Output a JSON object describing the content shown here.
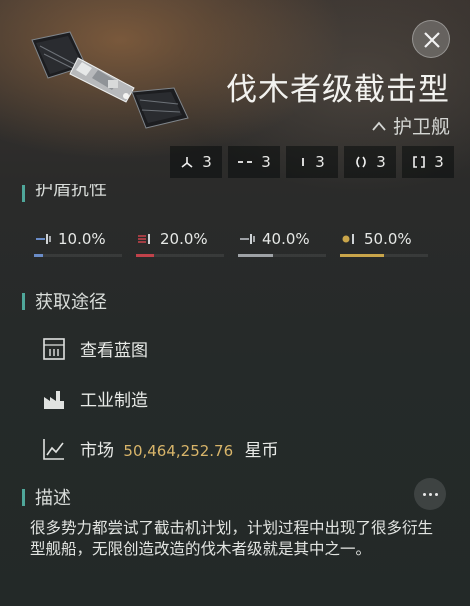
{
  "header": {
    "ship_name": "伐木者级截击型",
    "ship_class": "护卫舰",
    "slots": [
      {
        "icon": "three-prong-icon",
        "count": "3"
      },
      {
        "icon": "dash-icon",
        "count": "3"
      },
      {
        "icon": "tick-icon",
        "count": "3"
      },
      {
        "icon": "parenthesis-icon",
        "count": "3"
      },
      {
        "icon": "bracket-icon",
        "count": "3"
      }
    ]
  },
  "shield": {
    "title": "护盾抗性",
    "resists": [
      {
        "value": "10.0%",
        "fraction": 0.1,
        "color": "#6a8cc7",
        "icon": "em-resist-icon"
      },
      {
        "value": "20.0%",
        "fraction": 0.2,
        "color": "#c0424a",
        "icon": "thermal-resist-icon"
      },
      {
        "value": "40.0%",
        "fraction": 0.4,
        "color": "#9ea2a6",
        "icon": "kinetic-resist-icon"
      },
      {
        "value": "50.0%",
        "fraction": 0.5,
        "color": "#c9a54a",
        "icon": "explosive-resist-icon"
      }
    ]
  },
  "acquire": {
    "title": "获取途径",
    "blueprint_label": "查看蓝图",
    "industry_label": "工业制造",
    "market_label": "市场",
    "market_price": "50,464,252.76",
    "market_unit": "星币"
  },
  "description": {
    "title": "描述",
    "text": "很多势力都尝试了截击机计划，计划过程中出现了很多衍生型舰船，无限创造改造的伐木者级就是其中之一。"
  }
}
